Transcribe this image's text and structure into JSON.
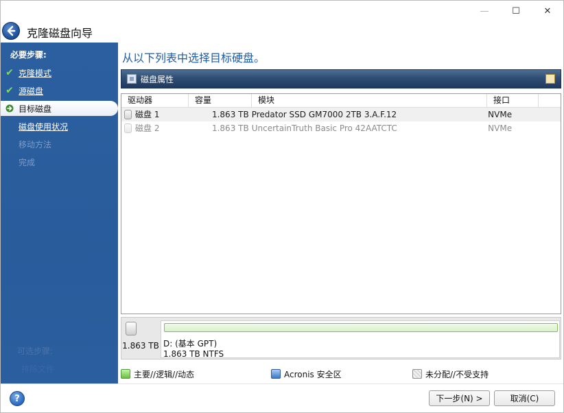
{
  "window": {
    "title": "克隆磁盘向导",
    "controls": {
      "minimize": "—",
      "maximize": "☐",
      "close": "✕"
    }
  },
  "sidebar": {
    "heading": "必要步骤:",
    "steps": [
      {
        "label": "克隆模式",
        "state": "done"
      },
      {
        "label": "源磁盘",
        "state": "done"
      },
      {
        "label": "目标磁盘",
        "state": "active"
      },
      {
        "label": "磁盘使用状况",
        "state": "link"
      },
      {
        "label": "移动方法",
        "state": "disabled"
      },
      {
        "label": "完成",
        "state": "disabled"
      }
    ],
    "faded": [
      "可选步骤:",
      "排除文件"
    ]
  },
  "main": {
    "instruction": "从以下列表中选择目标硬盘。",
    "properties_label": "磁盘属性",
    "table": {
      "columns": [
        "驱动器",
        "容量",
        "模块",
        "接口"
      ],
      "rows": [
        {
          "drive": "磁盘 1",
          "capacity": "1.863 TB",
          "model": "Predator SSD GM7000 2TB 3.A.F.12",
          "interface": "NVMe"
        },
        {
          "drive": "磁盘 2",
          "capacity": "1.863 TB",
          "model": "UncertainTruth Basic Pro 42AATCTC",
          "interface": "NVMe"
        }
      ]
    },
    "disk_panel": {
      "size": "1.863 TB",
      "partition_name": "D: (基本 GPT)",
      "partition_info": "1.863 TB  NTFS"
    },
    "legend": [
      {
        "label": "主要//逻辑//动态",
        "color": "#66c13f"
      },
      {
        "label": "Acronis 安全区",
        "color": "#3b78c9"
      },
      {
        "label": "未分配//不受支持",
        "color": "#d9d9d9"
      }
    ]
  },
  "footer": {
    "help": "?",
    "next_label": "下一步(N) >",
    "cancel_label": "取消(C)"
  },
  "colors": {
    "sidebar_bg": "#2b5f9f",
    "instruction_text": "#1d5bab",
    "props_bar": "#2f4d73"
  }
}
